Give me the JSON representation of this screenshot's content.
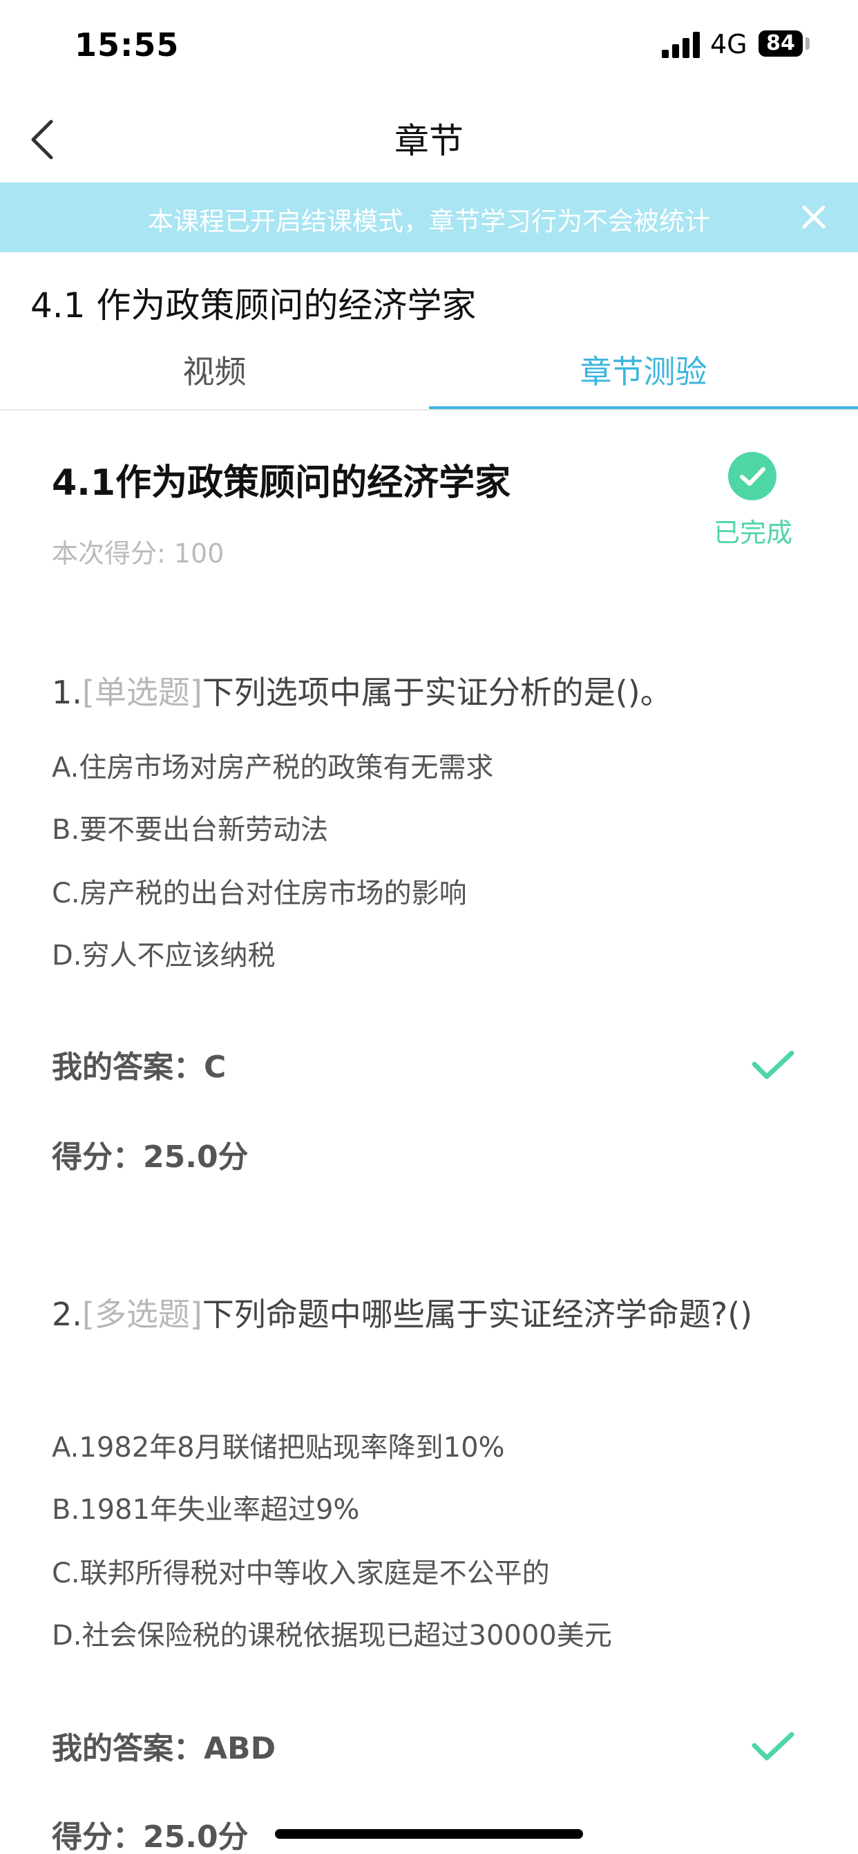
{
  "status_bar": {
    "time": "15:55",
    "network": "4G",
    "battery": "84"
  },
  "nav": {
    "title": "章节"
  },
  "banner": {
    "text": "本课程已开启结课模式，章节学习行为不会被统计"
  },
  "section": {
    "title": "4.1 作为政策顾问的经济学家"
  },
  "tabs": [
    {
      "label": "视频",
      "active": false
    },
    {
      "label": "章节测验",
      "active": true
    }
  ],
  "quiz": {
    "title": "4.1作为政策顾问的经济学家",
    "score_text": "本次得分: 100",
    "status": "已完成"
  },
  "questions": [
    {
      "num": "1.",
      "type": "[单选题]",
      "stem": "下列选项中属于实证分析的是()。",
      "options": [
        "A.住房市场对房产税的政策有无需求",
        "B.要不要出台新劳动法",
        "C.房产税的出台对住房市场的影响",
        "D.穷人不应该纳税"
      ],
      "my_answer": "我的答案：C",
      "score": "得分：25.0分"
    },
    {
      "num": "2.",
      "type": "[多选题]",
      "stem": "下列命题中哪些属于实证经济学命题?()",
      "options": [
        "A.1982年8月联储把贴现率降到10%",
        "B.1981年失业率超过9%",
        "C.联邦所得税对中等收入家庭是不公平的",
        "D.社会保险税的课税依据现已超过30000美元"
      ],
      "my_answer": "我的答案：ABD",
      "score": "得分：25.0分"
    }
  ],
  "colors": {
    "accent": "#3bb5dd",
    "banner": "#a9e5f2",
    "success": "#4fd6a5"
  },
  "icons": {
    "back": "chevron-left-icon",
    "close": "close-icon",
    "done": "check-circle-icon",
    "correct": "checkmark-icon"
  }
}
